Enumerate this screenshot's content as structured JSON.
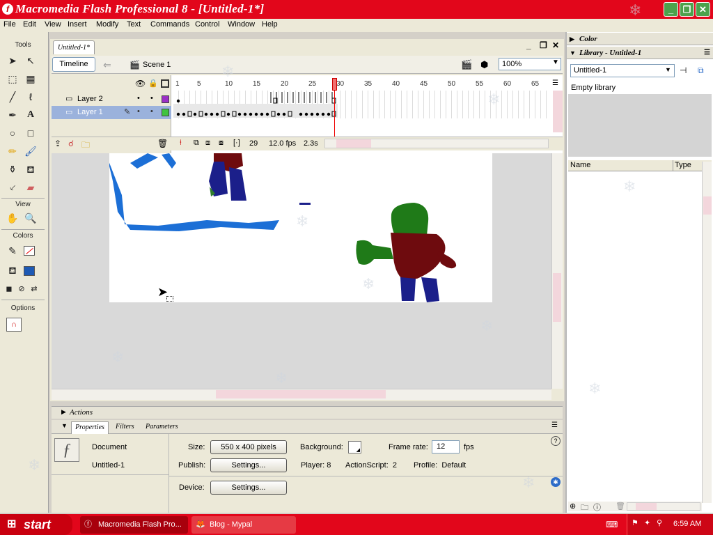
{
  "window": {
    "title": "Macromedia Flash Professional 8 - [Untitled-1*]",
    "controls": [
      "minimize",
      "restore",
      "close"
    ]
  },
  "menu": [
    "File",
    "Edit",
    "View",
    "Insert",
    "Modify",
    "Text",
    "Commands",
    "Control",
    "Window",
    "Help"
  ],
  "toolbox": {
    "tools_label": "Tools",
    "view_label": "View",
    "colors_label": "Colors",
    "options_label": "Options"
  },
  "document": {
    "tab": "Untitled-1*",
    "timeline_button": "Timeline",
    "scene": "Scene 1",
    "zoom": "100%"
  },
  "timeline": {
    "ruler": [
      "1",
      "5",
      "10",
      "15",
      "20",
      "25",
      "30",
      "35",
      "40",
      "45",
      "50",
      "55",
      "60",
      "65"
    ],
    "layers": [
      {
        "name": "Layer 2",
        "color": "#9b30c6",
        "selected": false
      },
      {
        "name": "Layer 1",
        "color": "#3fc43f",
        "selected": true
      }
    ],
    "current_frame": "29",
    "fps": "12.0 fps",
    "time": "2.3s"
  },
  "panels": {
    "actions": "Actions",
    "tabs": [
      "Properties",
      "Filters",
      "Parameters"
    ]
  },
  "properties": {
    "type": "Document",
    "name": "Untitled-1",
    "size_label": "Size:",
    "size_value": "550 x 400 pixels",
    "background_label": "Background:",
    "frame_rate_label": "Frame rate:",
    "frame_rate_value": "12",
    "fps_unit": "fps",
    "publish_label": "Publish:",
    "settings_label": "Settings...",
    "player": "Player: 8",
    "actionscript": "ActionScript:  2",
    "profile": "Profile:  Default",
    "device_label": "Device:",
    "device_settings_label": "Settings..."
  },
  "color_panel": {
    "title": "Color"
  },
  "library": {
    "title": "Library - Untitled-1",
    "selected_library": "Untitled-1",
    "status": "Empty library",
    "col_name": "Name",
    "col_type": "Type"
  },
  "taskbar": {
    "start": "start",
    "tasks": [
      "Macromedia Flash Pro...",
      "Blog - Mypal"
    ],
    "clock": "6:59 AM"
  }
}
